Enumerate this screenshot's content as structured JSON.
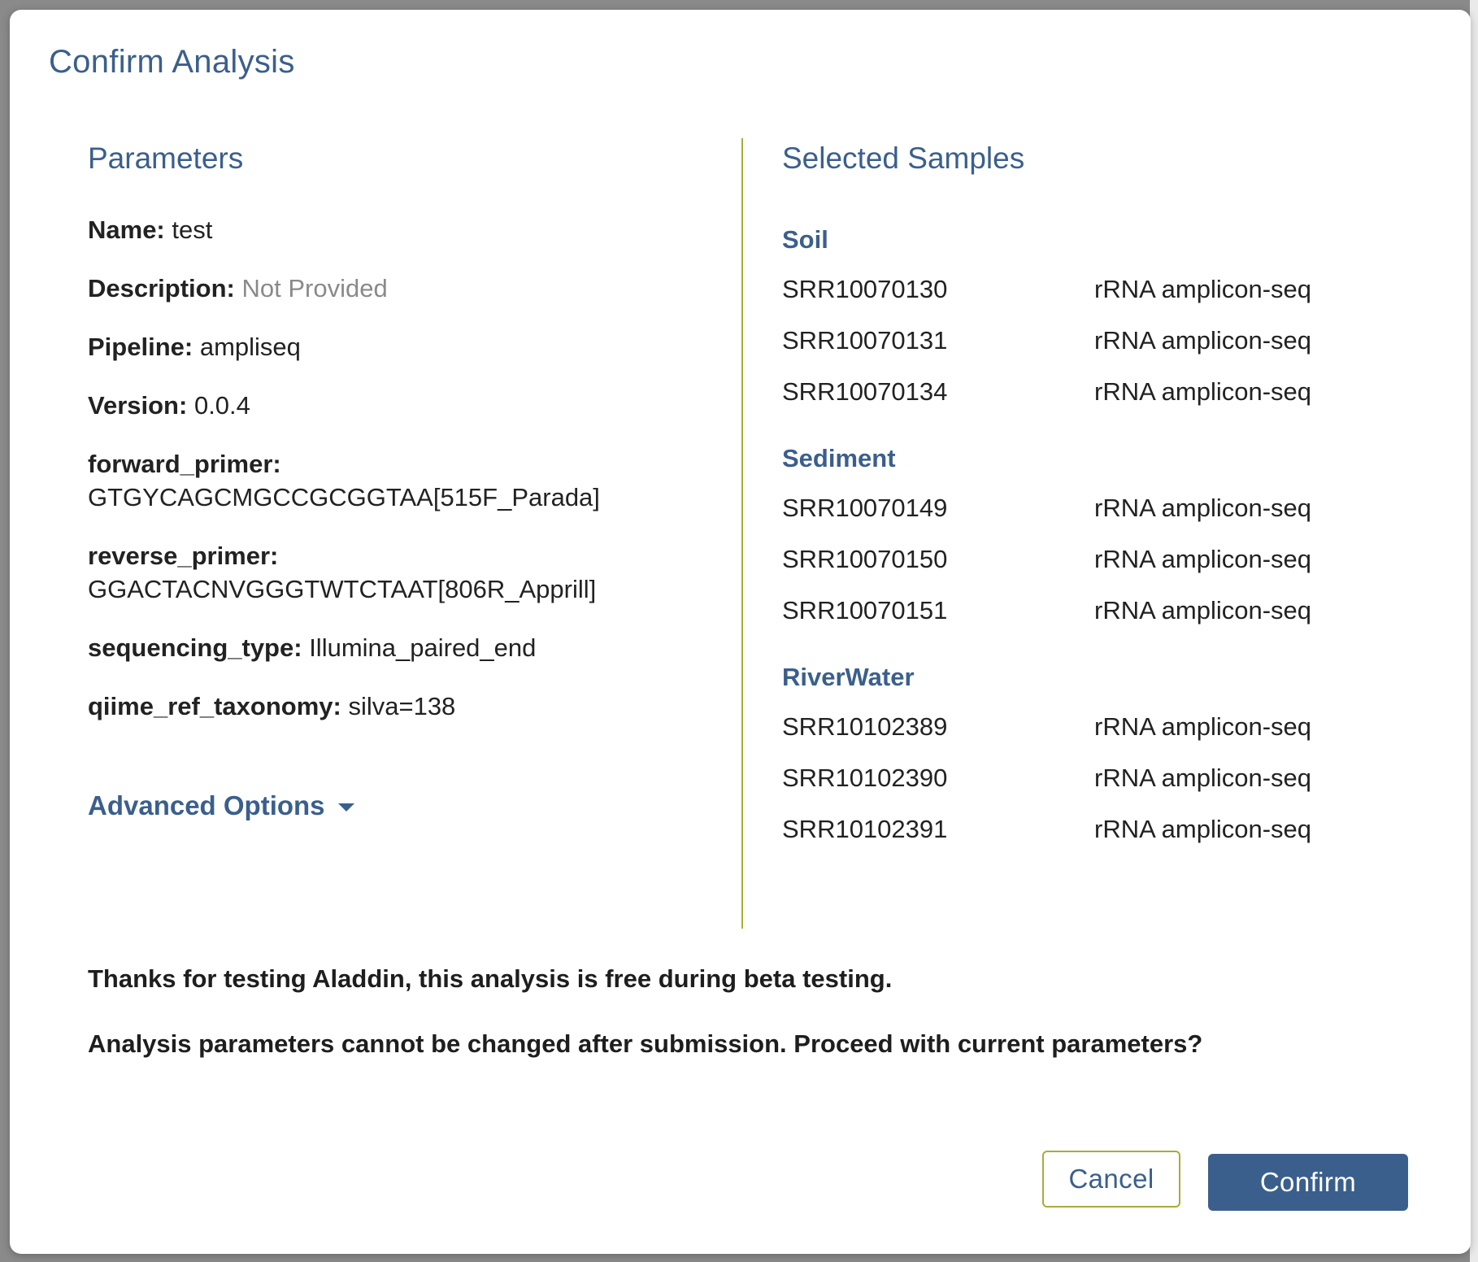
{
  "dialog": {
    "title": "Confirm Analysis"
  },
  "parameters": {
    "section_title": "Parameters",
    "items": [
      {
        "label": "Name:",
        "value": "test"
      },
      {
        "label": "Description:",
        "value": "Not Provided"
      },
      {
        "label": "Pipeline:",
        "value": "ampliseq"
      },
      {
        "label": "Version:",
        "value": "0.0.4"
      },
      {
        "label": "forward_primer:",
        "value": "GTGYCAGCMGCCGCGGTAA[515F_Parada]"
      },
      {
        "label": "reverse_primer:",
        "value": "GGACTACNVGGGTWTCTAAT[806R_Apprill]"
      },
      {
        "label": "sequencing_type:",
        "value": "Illumina_paired_end"
      },
      {
        "label": "qiime_ref_taxonomy:",
        "value": "silva=138"
      }
    ],
    "advanced_label": "Advanced Options"
  },
  "samples": {
    "section_title": "Selected Samples",
    "groups": [
      {
        "name": "Soil",
        "rows": [
          {
            "id": "SRR10070130",
            "type": "rRNA amplicon-seq"
          },
          {
            "id": "SRR10070131",
            "type": "rRNA amplicon-seq"
          },
          {
            "id": "SRR10070134",
            "type": "rRNA amplicon-seq"
          }
        ]
      },
      {
        "name": "Sediment",
        "rows": [
          {
            "id": "SRR10070149",
            "type": "rRNA amplicon-seq"
          },
          {
            "id": "SRR10070150",
            "type": "rRNA amplicon-seq"
          },
          {
            "id": "SRR10070151",
            "type": "rRNA amplicon-seq"
          }
        ]
      },
      {
        "name": "RiverWater",
        "rows": [
          {
            "id": "SRR10102389",
            "type": "rRNA amplicon-seq"
          },
          {
            "id": "SRR10102390",
            "type": "rRNA amplicon-seq"
          },
          {
            "id": "SRR10102391",
            "type": "rRNA amplicon-seq"
          }
        ]
      }
    ]
  },
  "notes": {
    "beta": "Thanks for testing Aladdin, this analysis is free during beta testing.",
    "warning": "Analysis parameters cannot be changed after submission. Proceed with current parameters?"
  },
  "actions": {
    "cancel_label": "Cancel",
    "confirm_label": "Confirm"
  },
  "colors": {
    "accent": "#3b5f8c",
    "divider": "#a7ad3a",
    "muted": "#8a8a8a"
  }
}
